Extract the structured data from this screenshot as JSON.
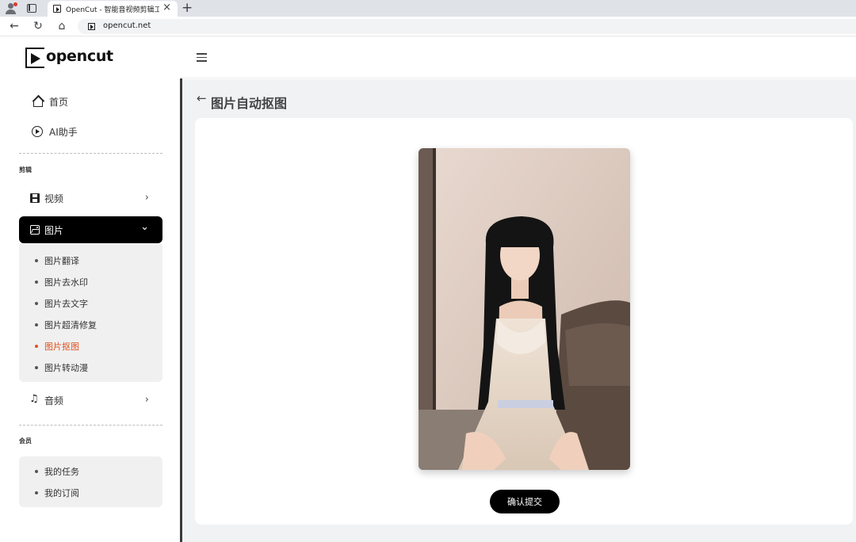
{
  "browser": {
    "tab_title": "OpenCut - 智能音视频剪辑工具",
    "tab_close": "×",
    "new_tab": "+",
    "url": "opencut.net",
    "back": "←",
    "reload": "↻",
    "home": "⌂"
  },
  "brand": {
    "logo_text": "opencut"
  },
  "sidebar": {
    "top_items": [
      {
        "label": "首页",
        "icon": "home-icon"
      },
      {
        "label": "AI助手",
        "icon": "play-circle-icon"
      }
    ],
    "section_edit": "剪辑",
    "menus": [
      {
        "label": "视频",
        "icon": "film-icon",
        "chevron": "›"
      },
      {
        "label": "图片",
        "icon": "image-icon",
        "chevron": "⌄"
      },
      {
        "label": "音频",
        "icon": "music-icon",
        "chevron": "›"
      }
    ],
    "image_submenu": [
      "图片翻译",
      "图片去水印",
      "图片去文字",
      "图片超清修复",
      "图片抠图",
      "图片转动漫"
    ],
    "section_member": "会员",
    "member_items": [
      "我的任务",
      "我的订阅"
    ]
  },
  "main": {
    "back_arrow": "←",
    "title": "图片自动抠图",
    "submit_label": "确认提交"
  },
  "colors": {
    "accent": "#000000",
    "active_submenu": "#e1501f",
    "main_bg": "#f1f2f4"
  }
}
